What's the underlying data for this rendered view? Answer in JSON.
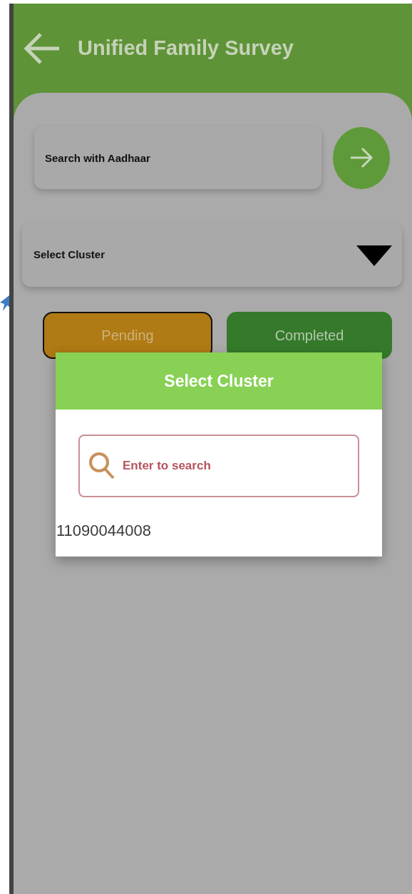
{
  "header": {
    "title": "Unified Family Survey"
  },
  "aadhaar_search": {
    "placeholder": "Search with Aadhaar"
  },
  "cluster_dropdown": {
    "label": "Select Cluster"
  },
  "tabs": [
    {
      "label": "Pending",
      "selected": true
    },
    {
      "label": "Completed",
      "selected": false
    }
  ],
  "dialog": {
    "title": "Select Cluster",
    "search": {
      "placeholder": "Enter to search"
    },
    "items": [
      "11090044008"
    ]
  }
}
